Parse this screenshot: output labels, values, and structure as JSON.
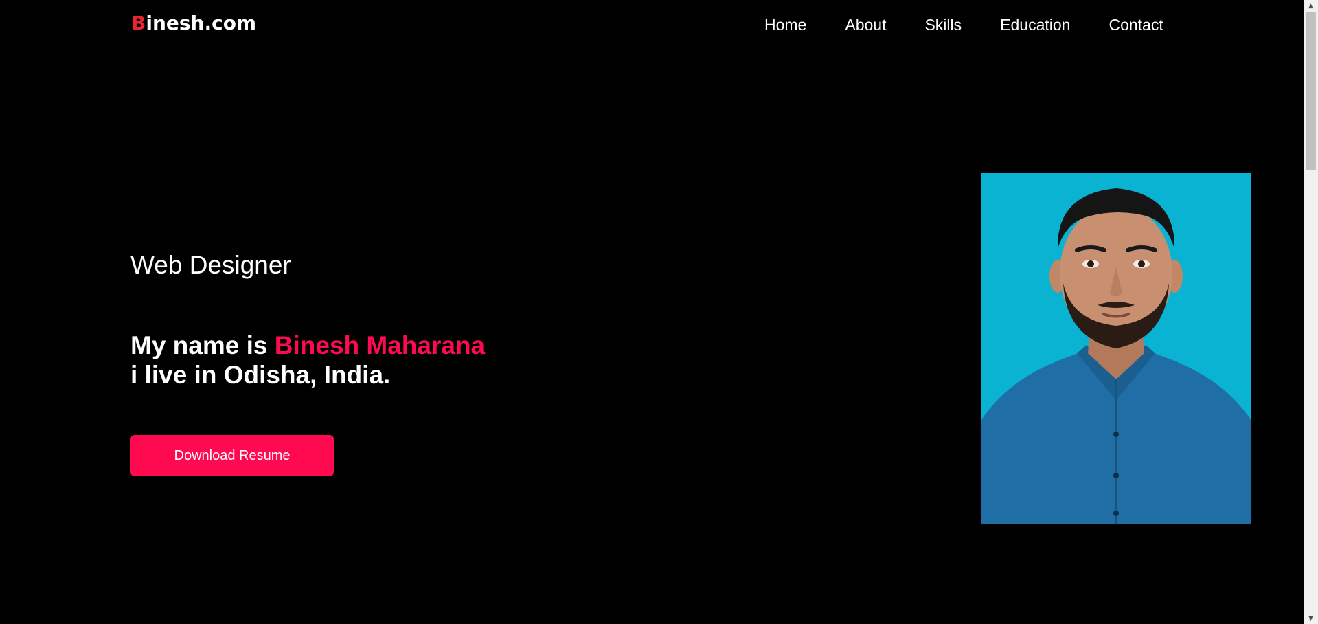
{
  "header": {
    "logo_first_letter": "B",
    "logo_rest": "inesh.com",
    "nav": [
      {
        "label": "Home"
      },
      {
        "label": "About"
      },
      {
        "label": "Skills"
      },
      {
        "label": "Education"
      },
      {
        "label": "Contact"
      }
    ]
  },
  "hero": {
    "subtitle": "Web Designer",
    "intro_prefix": "My name is ",
    "intro_name": "Binesh Maharana",
    "intro_line2": "i live in Odisha, India.",
    "cta_label": "Download Resume"
  },
  "colors": {
    "background": "#000000",
    "accent": "#ff0a50",
    "logo_accent": "#e8262f",
    "photo_background": "#0bb3d2",
    "text": "#ffffff"
  },
  "scrollbar": {
    "up_icon": "triangle-up-icon",
    "down_icon": "triangle-down-icon"
  }
}
